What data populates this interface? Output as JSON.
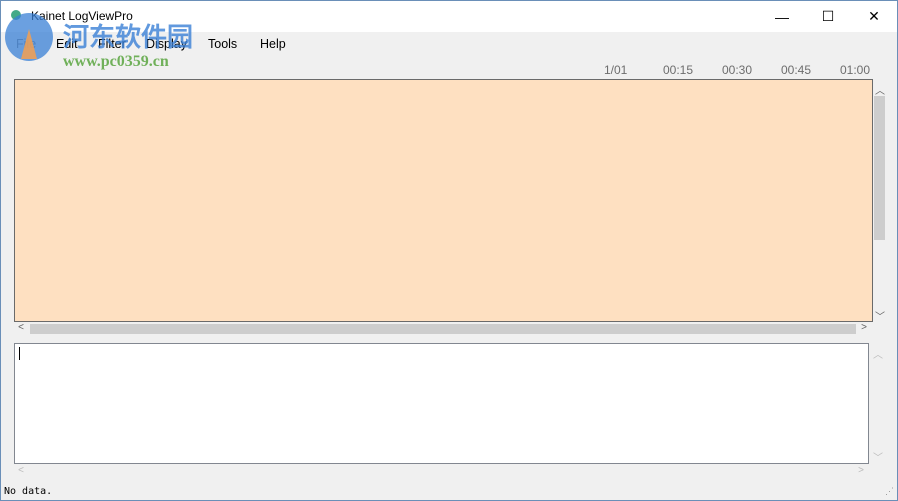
{
  "window": {
    "title": "Kainet LogViewPro",
    "minimize": "—",
    "maximize": "☐",
    "close": "✕"
  },
  "menu": [
    "File",
    "Edit",
    "Filter",
    "Display",
    "Tools",
    "Help"
  ],
  "timeline": {
    "ticks": [
      "1/01",
      "00:15",
      "00:30",
      "00:45",
      "01:00"
    ]
  },
  "log_pane": {
    "background": "#fee0c1"
  },
  "status": "No data.",
  "watermark": {
    "cn": "河东软件园",
    "url": "www.pc0359.cn"
  }
}
